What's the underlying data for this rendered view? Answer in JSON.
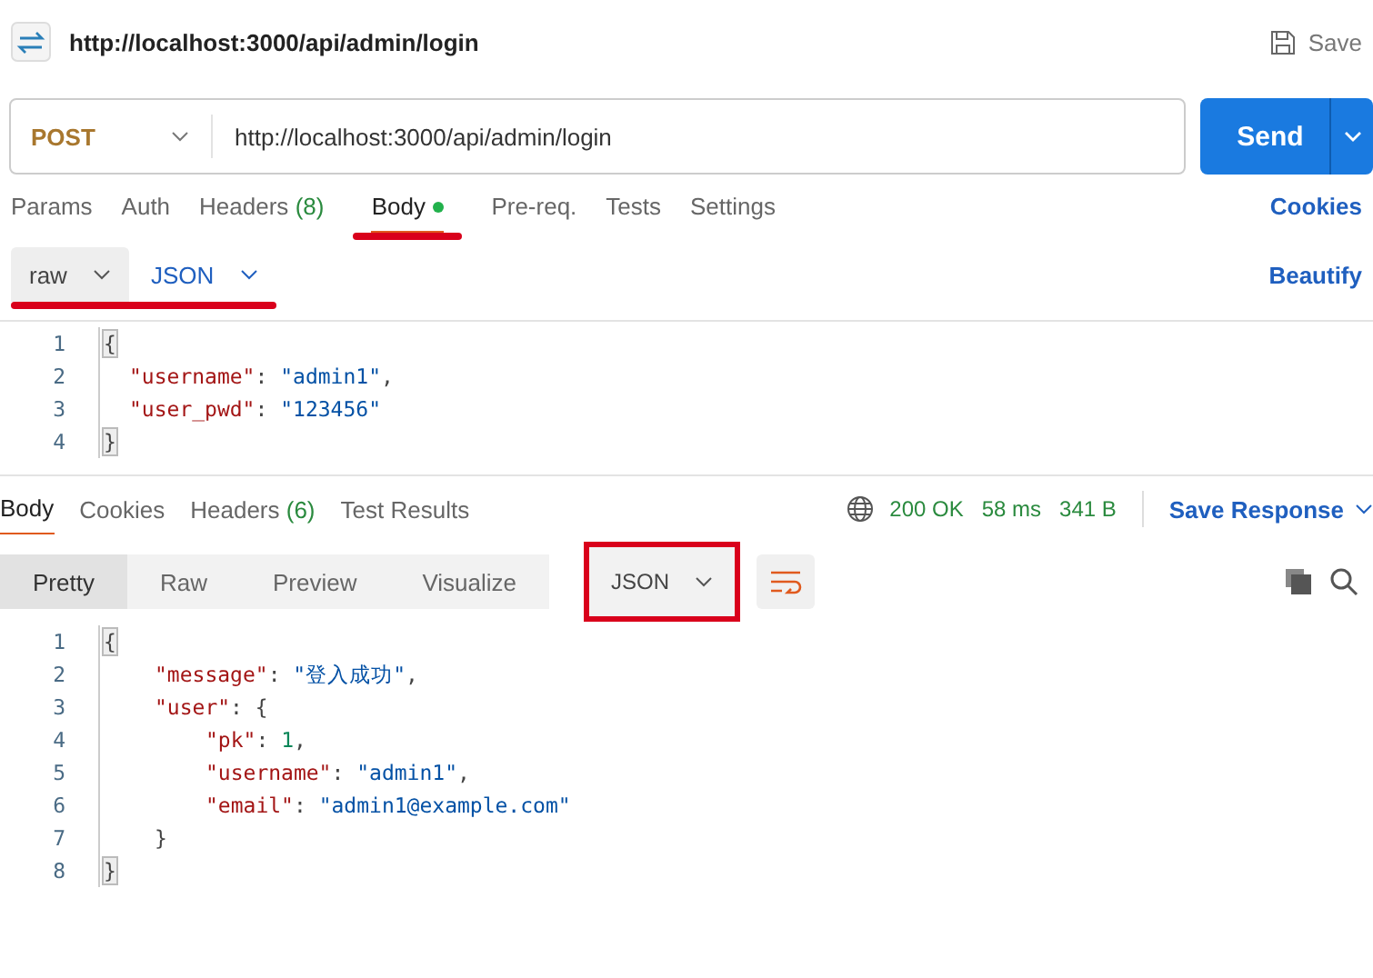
{
  "header": {
    "title": "http://localhost:3000/api/admin/login",
    "save": "Save"
  },
  "request": {
    "method": "POST",
    "url": "http://localhost:3000/api/admin/login",
    "send": "Send"
  },
  "request_tabs": [
    {
      "label": "Params",
      "selected": false
    },
    {
      "label": "Auth",
      "selected": false
    },
    {
      "label": "Headers",
      "count": "(8)",
      "selected": false
    },
    {
      "label": "Body",
      "selected": true,
      "dot": true,
      "highlighted": true
    },
    {
      "label": "Pre-req.",
      "selected": false
    },
    {
      "label": "Tests",
      "selected": false
    },
    {
      "label": "Settings",
      "selected": false
    }
  ],
  "cookies_link": "Cookies",
  "body_options": {
    "mode": "raw",
    "language": "JSON",
    "highlighted": true,
    "beautify": "Beautify"
  },
  "request_body": [
    {
      "number": "1",
      "tokens": [
        {
          "kind": "bracket",
          "text": "{"
        }
      ],
      "children": [
        {
          "number": "2",
          "tokens": [
            {
              "kind": "key",
              "text": "\"username\""
            },
            {
              "kind": "punct",
              "text": ": "
            },
            {
              "kind": "string",
              "text": "\"admin1\""
            },
            {
              "kind": "punct",
              "text": ","
            }
          ]
        },
        {
          "number": "3",
          "tokens": [
            {
              "kind": "key",
              "text": "\"user_pwd\""
            },
            {
              "kind": "punct",
              "text": ": "
            },
            {
              "kind": "string",
              "text": "\"123456\""
            }
          ]
        }
      ]
    },
    {
      "number": "4",
      "tokens": [
        {
          "kind": "bracket",
          "text": "}"
        }
      ]
    }
  ],
  "response_tabs": [
    {
      "label": "Body",
      "selected": true
    },
    {
      "label": "Cookies",
      "selected": false
    },
    {
      "label": "Headers",
      "count": "(6)",
      "selected": false
    },
    {
      "label": "Test Results",
      "selected": false
    }
  ],
  "response_status": {
    "status": "200 OK",
    "time": "58 ms",
    "size": "341 B",
    "save_response": "Save Response"
  },
  "view_modes": [
    {
      "label": "Pretty",
      "selected": true
    },
    {
      "label": "Raw",
      "selected": false
    },
    {
      "label": "Preview",
      "selected": false
    },
    {
      "label": "Visualize",
      "selected": false
    }
  ],
  "format": {
    "label": "JSON",
    "highlighted": true
  },
  "response_body": [
    {
      "number": "1",
      "tokens": [
        {
          "kind": "bracket",
          "text": "{"
        }
      ],
      "children": [
        {
          "number": "2",
          "tokens": [
            {
              "kind": "key",
              "text": "\"message\""
            },
            {
              "kind": "punct",
              "text": ": "
            },
            {
              "kind": "string",
              "text": "\"登入成功\""
            },
            {
              "kind": "punct",
              "text": ","
            }
          ]
        },
        {
          "number": "3",
          "tokens": [
            {
              "kind": "key",
              "text": "\"user\""
            },
            {
              "kind": "punct",
              "text": ": {"
            }
          ],
          "children": [
            {
              "number": "4",
              "tokens": [
                {
                  "kind": "key",
                  "text": "\"pk\""
                },
                {
                  "kind": "punct",
                  "text": ": "
                },
                {
                  "kind": "number",
                  "text": "1"
                },
                {
                  "kind": "punct",
                  "text": ","
                }
              ]
            },
            {
              "number": "5",
              "tokens": [
                {
                  "kind": "key",
                  "text": "\"username\""
                },
                {
                  "kind": "punct",
                  "text": ": "
                },
                {
                  "kind": "string",
                  "text": "\"admin1\""
                },
                {
                  "kind": "punct",
                  "text": ","
                }
              ]
            },
            {
              "number": "6",
              "tokens": [
                {
                  "kind": "key",
                  "text": "\"email\""
                },
                {
                  "kind": "punct",
                  "text": ": "
                },
                {
                  "kind": "string",
                  "text": "\"admin1@example.com\""
                }
              ]
            }
          ]
        },
        {
          "number": "7",
          "tokens": [
            {
              "kind": "punct",
              "text": "}"
            }
          ]
        }
      ]
    },
    {
      "number": "8",
      "tokens": [
        {
          "kind": "bracket",
          "text": "}"
        }
      ]
    }
  ]
}
